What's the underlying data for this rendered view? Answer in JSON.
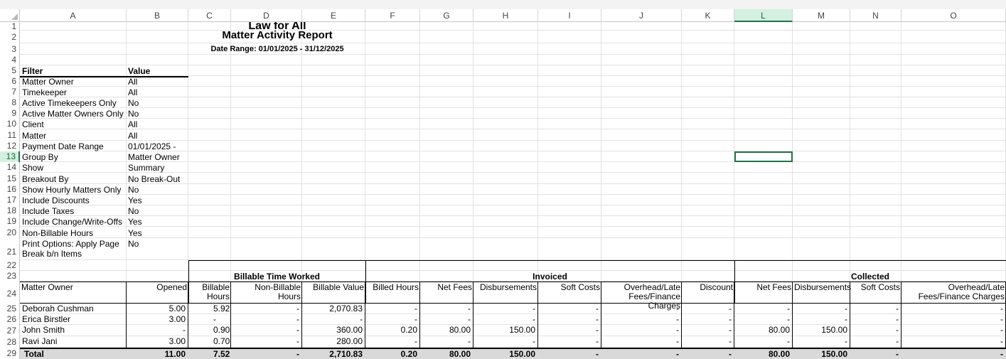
{
  "columns": [
    "A",
    "B",
    "C",
    "D",
    "E",
    "F",
    "G",
    "H",
    "I",
    "J",
    "K",
    "L",
    "M",
    "N",
    "O"
  ],
  "selected_column": "L",
  "selected_row": "13",
  "rows": [
    "1",
    "2",
    "3",
    "4",
    "5",
    "6",
    "7",
    "8",
    "9",
    "10",
    "11",
    "12",
    "13",
    "14",
    "15",
    "16",
    "17",
    "18",
    "19",
    "20",
    "21",
    "22",
    "23",
    "24",
    "25",
    "26",
    "27",
    "28",
    "29"
  ],
  "report": {
    "firm": "Law for All",
    "title": "Matter Activity Report",
    "date_range": "Date Range: 01/01/2025  -  31/12/2025"
  },
  "filters": {
    "header_filter": "Filter",
    "header_value": "Value",
    "items": [
      {
        "filter": "Matter Owner",
        "value": "All"
      },
      {
        "filter": "Timekeeper",
        "value": "All"
      },
      {
        "filter": "Active Timekeepers Only",
        "value": "No"
      },
      {
        "filter": "Active Matter Owners Only",
        "value": "No"
      },
      {
        "filter": "Client",
        "value": "All"
      },
      {
        "filter": "Matter",
        "value": "All"
      },
      {
        "filter": "Payment Date Range",
        "value": "01/01/2025 -"
      },
      {
        "filter": "Group By",
        "value": "Matter Owner"
      },
      {
        "filter": "Show",
        "value": "Summary"
      },
      {
        "filter": "Breakout By",
        "value": "No Break-Out"
      },
      {
        "filter": "Show Hourly Matters Only",
        "value": "No"
      },
      {
        "filter": "Include Discounts",
        "value": "Yes"
      },
      {
        "filter": "Include Taxes",
        "value": "No"
      },
      {
        "filter": "Include Change/Write-Offs",
        "value": "Yes"
      },
      {
        "filter": "Non-Billable Hours",
        "value": "Yes"
      },
      {
        "filter": "Print Options: Apply Page Break b/n Items",
        "value": "No"
      }
    ]
  },
  "groups": {
    "billable": "Billable Time Worked",
    "invoiced": "Invoiced",
    "collected": "Collected"
  },
  "table_headers": {
    "matter_owner": "Matter Owner",
    "opened": "Opened",
    "billable_hours": "Billable Hours",
    "non_billable_hours": "Non-Billable Hours",
    "billable_value": "Billable Value",
    "billed_hours": "Billed Hours",
    "net_fees": "Net Fees",
    "disbursements": "Disbursements",
    "soft_costs": "Soft Costs",
    "overhead": "Overhead/Late Fees/Finance Charges",
    "discount": "Discount",
    "c_net_fees": "Net Fees",
    "c_disbursements": "Disbursements",
    "c_soft_costs": "Soft Costs",
    "c_overhead": "Overhead/Late Fees/Finance Charges"
  },
  "data_rows": [
    {
      "owner": "Deborah Cushman",
      "vals": [
        "5.00",
        "5.92",
        "-",
        "2,070.83",
        "-",
        "-",
        "-",
        "-",
        "-",
        "-",
        "-",
        "-",
        "-",
        "-"
      ]
    },
    {
      "owner": "Erica Birstler",
      "vals": [
        "3.00",
        "-",
        "-",
        "-",
        "-",
        "-",
        "-",
        "-",
        "-",
        "-",
        "-",
        "-",
        "-",
        "-"
      ]
    },
    {
      "owner": "John Smith",
      "vals": [
        "-",
        "0.90",
        "-",
        "360.00",
        "0.20",
        "80.00",
        "150.00",
        "-",
        "-",
        "-",
        "80.00",
        "150.00",
        "-",
        "-"
      ]
    },
    {
      "owner": "Ravi Jani",
      "vals": [
        "3.00",
        "0.70",
        "-",
        "280.00",
        "-",
        "-",
        "-",
        "-",
        "-",
        "-",
        "-",
        "-",
        "-",
        "-"
      ]
    }
  ],
  "total": {
    "label": "Total",
    "vals": [
      "11.00",
      "7.52",
      "-",
      "2,710.83",
      "0.20",
      "80.00",
      "150.00",
      "-",
      "-",
      "-",
      "80.00",
      "150.00",
      "-",
      "-"
    ]
  }
}
